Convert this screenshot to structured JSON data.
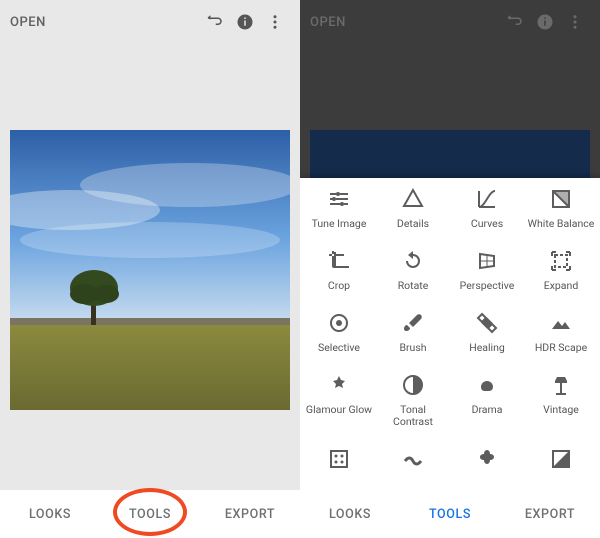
{
  "left": {
    "open_label": "OPEN",
    "tabs": {
      "looks": "LOOKS",
      "tools": "TOOLS",
      "export": "EXPORT"
    }
  },
  "right": {
    "open_label": "OPEN",
    "tabs": {
      "looks": "LOOKS",
      "tools": "TOOLS",
      "export": "EXPORT"
    }
  },
  "tools": [
    {
      "id": "tune",
      "label": "Tune Image"
    },
    {
      "id": "details",
      "label": "Details"
    },
    {
      "id": "curves",
      "label": "Curves"
    },
    {
      "id": "wbalance",
      "label": "White Balance"
    },
    {
      "id": "crop",
      "label": "Crop"
    },
    {
      "id": "rotate",
      "label": "Rotate"
    },
    {
      "id": "perspective",
      "label": "Perspective"
    },
    {
      "id": "expand",
      "label": "Expand"
    },
    {
      "id": "selective",
      "label": "Selective"
    },
    {
      "id": "brush",
      "label": "Brush"
    },
    {
      "id": "healing",
      "label": "Healing"
    },
    {
      "id": "hdrscape",
      "label": "HDR Scape"
    },
    {
      "id": "glamour",
      "label": "Glamour Glow"
    },
    {
      "id": "tonal",
      "label": "Tonal Contrast"
    },
    {
      "id": "drama",
      "label": "Drama"
    },
    {
      "id": "vintage",
      "label": "Vintage"
    },
    {
      "id": "grainy",
      "label": ""
    },
    {
      "id": "retrolux",
      "label": ""
    },
    {
      "id": "grunge",
      "label": ""
    },
    {
      "id": "bw",
      "label": ""
    }
  ]
}
